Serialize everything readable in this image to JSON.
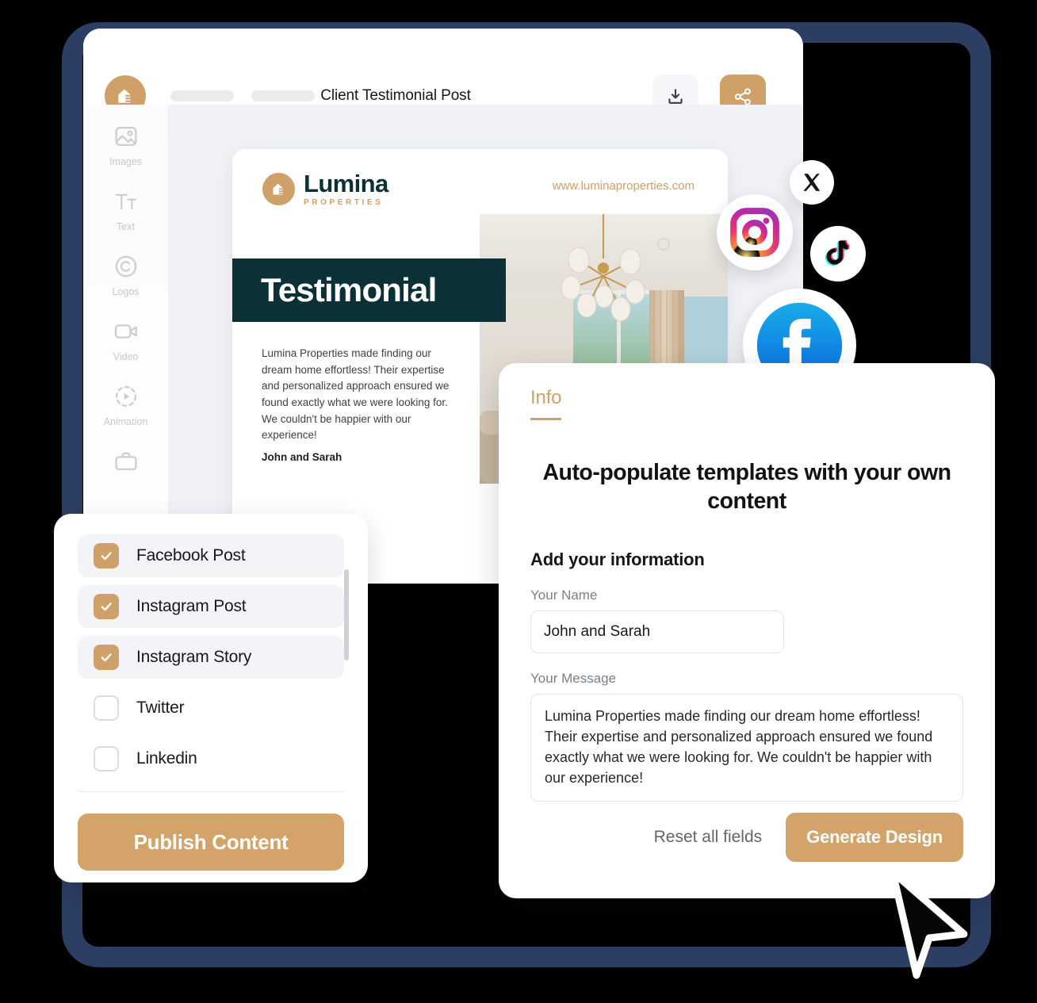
{
  "colors": {
    "accent_tan": "#cfa169",
    "button_tan": "#d3a369",
    "navy_frame": "#2c3e63",
    "dark_teal": "#0b3035",
    "canvas_bg": "#f1f2f6"
  },
  "app": {
    "header": {
      "logo_icon": "house-logo-icon",
      "document_title": "Client Testimonial Post",
      "download_icon": "download-icon",
      "share_icon": "share-icon"
    },
    "tool_rail": [
      {
        "label": "Images",
        "icon": "image-icon"
      },
      {
        "label": "Text",
        "icon": "text-icon"
      },
      {
        "label": "Logos",
        "icon": "copyright-logo-icon"
      },
      {
        "label": "Video",
        "icon": "video-camera-icon"
      },
      {
        "label": "Animation",
        "icon": "animation-play-icon"
      },
      {
        "label": "",
        "icon": "briefcase-icon"
      }
    ]
  },
  "template": {
    "brand_name": "Lumina",
    "brand_subtitle": "PROPERTIES",
    "brand_logo_icon": "house-logo-icon",
    "website": "www.luminaproperties.com",
    "banner_heading": "Testimonial",
    "body_text": "Lumina Properties made finding our dream home effortless! Their expertise and personalized approach ensured we found exactly what we were looking for. We couldn't be happier with our experience!",
    "author": "John and Sarah",
    "photo_alt": "interior-living-room-chandelier"
  },
  "social_bubbles": [
    {
      "name": "x-twitter-icon",
      "label": "X"
    },
    {
      "name": "instagram-icon",
      "label": "Instagram"
    },
    {
      "name": "tiktok-icon",
      "label": "TikTok"
    },
    {
      "name": "facebook-icon",
      "label": "Facebook"
    }
  ],
  "checklist": {
    "items": [
      {
        "label": "Facebook Post",
        "checked": true
      },
      {
        "label": "Instagram Post",
        "checked": true
      },
      {
        "label": "Instagram Story",
        "checked": true
      },
      {
        "label": "Twitter",
        "checked": false
      },
      {
        "label": "Linkedin",
        "checked": false
      }
    ],
    "publish_label": "Publish Content"
  },
  "info_panel": {
    "tab_label": "Info",
    "title": "Auto-populate templates with your own content",
    "section_heading": "Add your information",
    "name_label": "Your Name",
    "name_value": "John and Sarah",
    "name_placeholder": "Your Name",
    "message_label": "Your Message",
    "message_value": "Lumina Properties made finding our dream home effortless! Their expertise and personalized approach ensured we found exactly what we were looking for. We couldn't be happier with our experience!",
    "message_placeholder": "Your Message",
    "reset_label": "Reset all fields",
    "generate_label": "Generate Design"
  }
}
